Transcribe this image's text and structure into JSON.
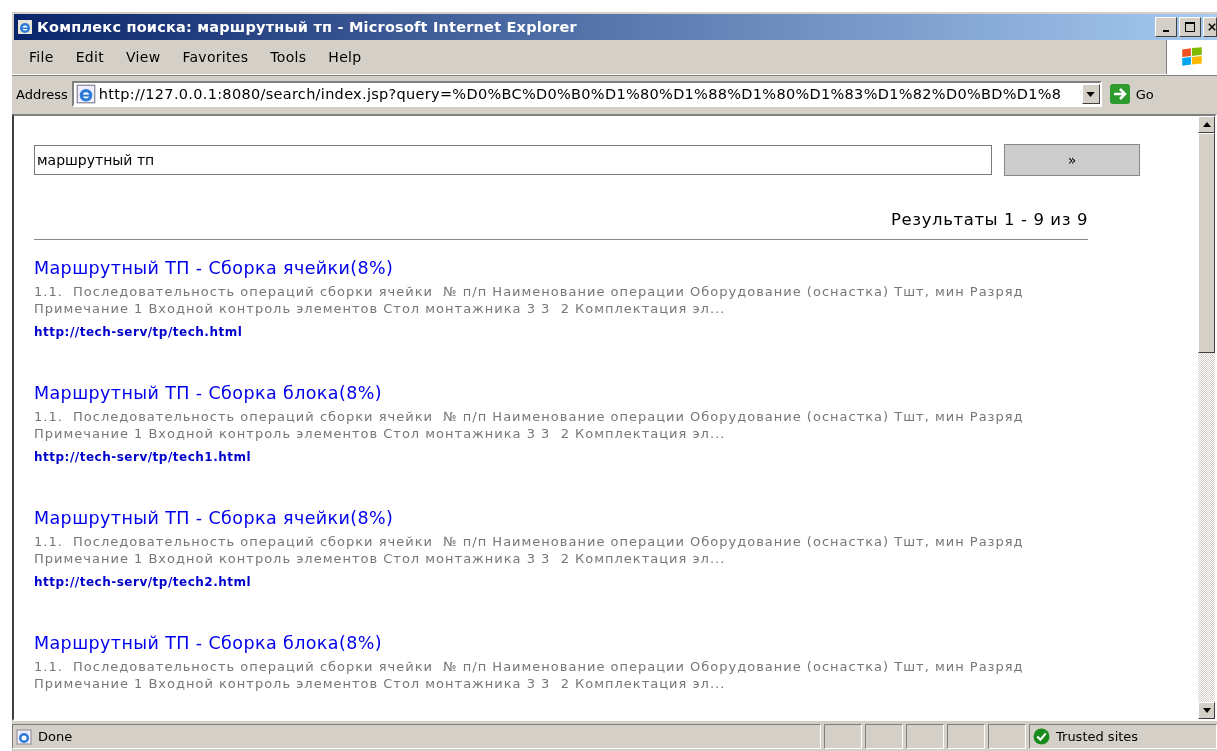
{
  "window": {
    "title": "Комплекс поиска: маршрутный тп - Microsoft Internet Explorer"
  },
  "menu": [
    "File",
    "Edit",
    "View",
    "Favorites",
    "Tools",
    "Help"
  ],
  "address": {
    "label": "Address",
    "url": "http://127.0.0.1:8080/search/index.jsp?query=%D0%BC%D0%B0%D1%80%D1%88%D1%80%D1%83%D1%82%D0%BD%D1%8",
    "go": "Go"
  },
  "search": {
    "value": "маршрутный тп",
    "button": "»"
  },
  "summary": "Результаты 1 - 9 из 9",
  "results": [
    {
      "title": "Маршрутный ТП - Сборка ячейки(8%)",
      "snippet": "1.1.  Последовательность операций сборки ячейки  № п/п Наименование операции Оборудование (оснастка) Тшт, мин Разряд Примечание 1 Входной контроль элементов Стол монтажника 3 3  2 Комплектация эл...",
      "url": "http://tech-serv/tp/tech.html"
    },
    {
      "title": "Маршрутный ТП - Сборка блока(8%)",
      "snippet": "1.1.  Последовательность операций сборки ячейки  № п/п Наименование операции Оборудование (оснастка) Тшт, мин Разряд Примечание 1 Входной контроль элементов Стол монтажника 3 3  2 Комплектация эл...",
      "url": "http://tech-serv/tp/tech1.html"
    },
    {
      "title": "Маршрутный ТП - Сборка ячейки(8%)",
      "snippet": "1.1.  Последовательность операций сборки ячейки  № п/п Наименование операции Оборудование (оснастка) Тшт, мин Разряд Примечание 1 Входной контроль элементов Стол монтажника 3 3  2 Комплектация эл...",
      "url": "http://tech-serv/tp/tech2.html"
    },
    {
      "title": "Маршрутный ТП - Сборка блока(8%)",
      "snippet": "1.1.  Последовательность операций сборки ячейки  № п/п Наименование операции Оборудование (оснастка) Тшт, мин Разряд Примечание 1 Входной контроль элементов Стол монтажника 3 3  2 Комплектация эл..."
    }
  ],
  "status": {
    "text": "Done",
    "zone": "Trusted sites"
  }
}
